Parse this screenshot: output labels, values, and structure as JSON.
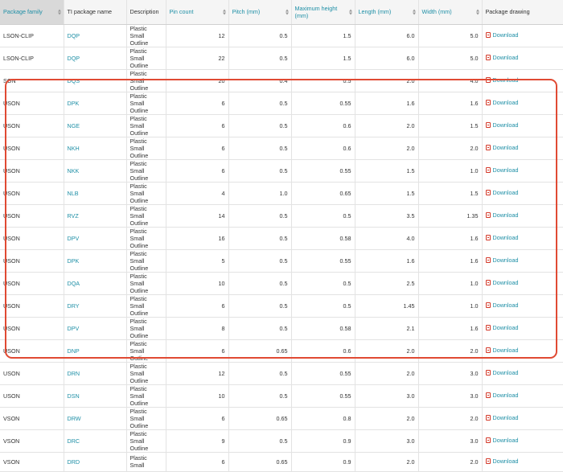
{
  "columns": [
    {
      "label": "Package family",
      "sortable": true,
      "active": true
    },
    {
      "label": "TI package name",
      "sortable": false,
      "active": false
    },
    {
      "label": "Description",
      "sortable": false,
      "active": false
    },
    {
      "label": "Pin count",
      "sortable": true,
      "active": false
    },
    {
      "label": "Pitch (mm)",
      "sortable": true,
      "active": false
    },
    {
      "label": "Maximum height (mm)",
      "sortable": true,
      "active": false
    },
    {
      "label": "Length (mm)",
      "sortable": true,
      "active": false
    },
    {
      "label": "Width (mm)",
      "sortable": true,
      "active": false
    },
    {
      "label": "Package drawing",
      "sortable": false,
      "active": false
    }
  ],
  "download_label": "Download",
  "rows": [
    {
      "family": "LSON-CLIP",
      "name": "DQP",
      "desc": "Plastic Small Outline",
      "pins": "12",
      "pitch": "0.5",
      "height": "1.5",
      "length": "6.0",
      "width": "5.0"
    },
    {
      "family": "LSON-CLIP",
      "name": "DQP",
      "desc": "Plastic Small Outline",
      "pins": "22",
      "pitch": "0.5",
      "height": "1.5",
      "length": "6.0",
      "width": "5.0"
    },
    {
      "family": "SON",
      "name": "DQS",
      "desc": "Plastic Small Outline",
      "pins": "20",
      "pitch": "0.4",
      "height": "0.5",
      "length": "2.0",
      "width": "4.0"
    },
    {
      "family": "USON",
      "name": "DPK",
      "desc": "Plastic Small Outline",
      "pins": "6",
      "pitch": "0.5",
      "height": "0.55",
      "length": "1.6",
      "width": "1.6"
    },
    {
      "family": "USON",
      "name": "NGE",
      "desc": "Plastic Small Outline",
      "pins": "6",
      "pitch": "0.5",
      "height": "0.6",
      "length": "2.0",
      "width": "1.5"
    },
    {
      "family": "USON",
      "name": "NKH",
      "desc": "Plastic Small Outline",
      "pins": "6",
      "pitch": "0.5",
      "height": "0.6",
      "length": "2.0",
      "width": "2.0"
    },
    {
      "family": "USON",
      "name": "NKK",
      "desc": "Plastic Small Outline",
      "pins": "6",
      "pitch": "0.5",
      "height": "0.55",
      "length": "1.5",
      "width": "1.0"
    },
    {
      "family": "USON",
      "name": "NLB",
      "desc": "Plastic Small Outline",
      "pins": "4",
      "pitch": "1.0",
      "height": "0.65",
      "length": "1.5",
      "width": "1.5"
    },
    {
      "family": "USON",
      "name": "RVZ",
      "desc": "Plastic Small Outline",
      "pins": "14",
      "pitch": "0.5",
      "height": "0.5",
      "length": "3.5",
      "width": "1.35"
    },
    {
      "family": "USON",
      "name": "DPV",
      "desc": "Plastic Small Outline",
      "pins": "16",
      "pitch": "0.5",
      "height": "0.58",
      "length": "4.0",
      "width": "1.6"
    },
    {
      "family": "USON",
      "name": "DPK",
      "desc": "Plastic Small Outline",
      "pins": "5",
      "pitch": "0.5",
      "height": "0.55",
      "length": "1.6",
      "width": "1.6"
    },
    {
      "family": "USON",
      "name": "DQA",
      "desc": "Plastic Small Outline",
      "pins": "10",
      "pitch": "0.5",
      "height": "0.5",
      "length": "2.5",
      "width": "1.0"
    },
    {
      "family": "USON",
      "name": "DRY",
      "desc": "Plastic Small Outline",
      "pins": "6",
      "pitch": "0.5",
      "height": "0.5",
      "length": "1.45",
      "width": "1.0"
    },
    {
      "family": "USON",
      "name": "DPV",
      "desc": "Plastic Small Outline",
      "pins": "8",
      "pitch": "0.5",
      "height": "0.58",
      "length": "2.1",
      "width": "1.6"
    },
    {
      "family": "USON",
      "name": "DNP",
      "desc": "Plastic Small Outline",
      "pins": "6",
      "pitch": "0.65",
      "height": "0.6",
      "length": "2.0",
      "width": "2.0"
    },
    {
      "family": "USON",
      "name": "DRN",
      "desc": "Plastic Small Outline",
      "pins": "12",
      "pitch": "0.5",
      "height": "0.55",
      "length": "2.0",
      "width": "3.0"
    },
    {
      "family": "USON",
      "name": "DSN",
      "desc": "Plastic Small Outline",
      "pins": "10",
      "pitch": "0.5",
      "height": "0.55",
      "length": "3.0",
      "width": "3.0"
    },
    {
      "family": "VSON",
      "name": "DRW",
      "desc": "Plastic Small Outline",
      "pins": "6",
      "pitch": "0.65",
      "height": "0.8",
      "length": "2.0",
      "width": "2.0"
    },
    {
      "family": "VSON",
      "name": "DRC",
      "desc": "Plastic Small Outline",
      "pins": "9",
      "pitch": "0.5",
      "height": "0.9",
      "length": "3.0",
      "width": "3.0"
    },
    {
      "family": "VSON",
      "name": "DRD",
      "desc": "Plastic Small",
      "pins": "6",
      "pitch": "0.65",
      "height": "0.9",
      "length": "2.0",
      "width": "2.0"
    }
  ]
}
